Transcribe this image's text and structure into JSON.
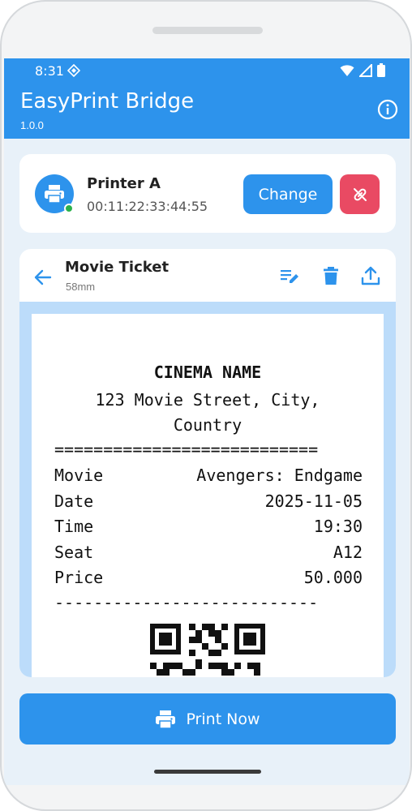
{
  "status_bar": {
    "time": "8:31"
  },
  "app": {
    "title": "EasyPrint Bridge",
    "version": "1.0.0"
  },
  "printer": {
    "name": "Printer A",
    "mac": "00:11:22:33:44:55",
    "connected": true,
    "change_label": "Change"
  },
  "template": {
    "title": "Movie Ticket",
    "paper_size": "58mm"
  },
  "receipt": {
    "title": "CINEMA NAME",
    "address_line1": "123 Movie Street, City,",
    "address_line2": "Country",
    "separator_double": "===========================",
    "rows": [
      {
        "label": "Movie",
        "value": "Avengers: Endgame"
      },
      {
        "label": "Date",
        "value": "2025-11-05"
      },
      {
        "label": "Time",
        "value": "19:30"
      },
      {
        "label": "Seat",
        "value": "A12"
      },
      {
        "label": "Price",
        "value": "50.000"
      }
    ],
    "separator_single": "---------------------------"
  },
  "actions": {
    "print_label": "Print Now"
  },
  "colors": {
    "primary": "#2d93ec",
    "danger": "#e94a63",
    "online": "#2bb14b",
    "preview_bg": "#bcdcfa"
  },
  "icons": {
    "wifi": "wifi-icon",
    "signal": "signal-icon",
    "battery": "battery-icon",
    "info": "info-icon",
    "printer": "printer-icon",
    "disconnect": "link-off-icon",
    "back": "arrow-left-icon",
    "edit": "edit-note-icon",
    "delete": "trash-icon",
    "share": "upload-icon"
  }
}
